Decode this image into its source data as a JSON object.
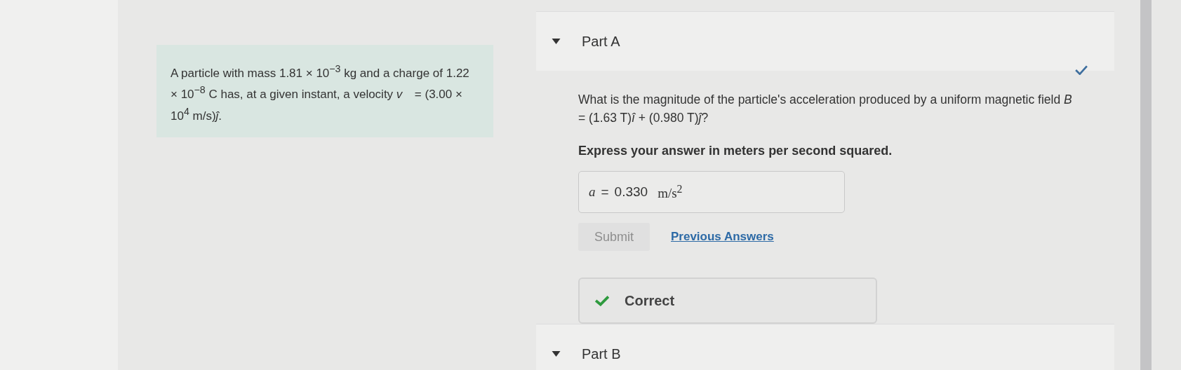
{
  "problem": {
    "text": "A particle with mass 1.81 × 10$^{−3}$ kg and a charge of 1.22 × 10$^{−8}$ C has, at a given instant, a velocity *v⃗* = (3.00 × 10$^{4}$ m/s)*ĵ*."
  },
  "parts": [
    {
      "title": "Part A",
      "expanded": true,
      "completed": true,
      "question": "What is the magnitude of the particle's acceleration produced by a uniform magnetic field *B⃗* = (1.63 T)*î* + (0.980 T)*ĵ*?",
      "instruction": "Express your answer in meters per second squared.",
      "answer": {
        "label": "a",
        "equals": "=",
        "value": "0.330",
        "unit": "m/s$^{2}$"
      },
      "submit": {
        "label": "Submit",
        "disabled": true
      },
      "previous_link": "Previous Answers",
      "feedback": {
        "kind": "correct",
        "text": "Correct"
      }
    },
    {
      "title": "Part B",
      "expanded": true
    }
  ]
}
